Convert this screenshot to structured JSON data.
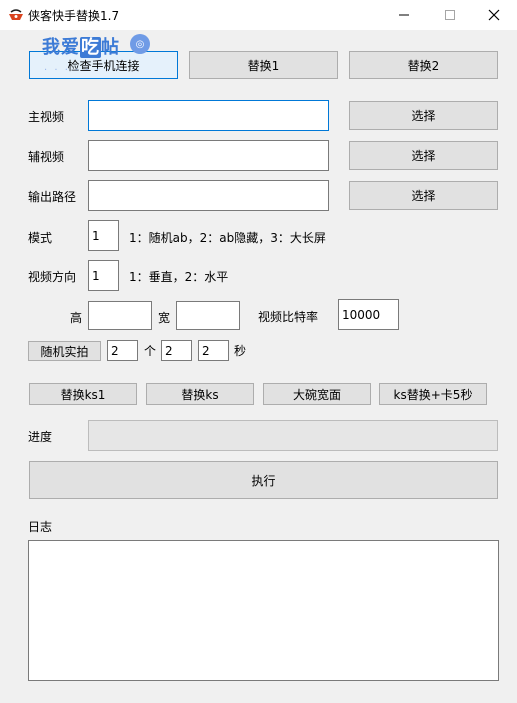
{
  "window": {
    "title": "侠客快手替换1.7",
    "minimize": "—",
    "maximize": "☐",
    "close": "✕"
  },
  "watermark": {
    "part1": "我爱",
    "part2": "吃",
    "part3": "帖",
    "badge": "◎"
  },
  "top_buttons": {
    "check_phone": "检查手机连接",
    "replace1": "替换1",
    "replace2": "替换2"
  },
  "fields": {
    "main_video": {
      "label": "主视频",
      "value": ""
    },
    "aux_video": {
      "label": "辅视频",
      "value": ""
    },
    "output_path": {
      "label": "输出路径",
      "value": ""
    },
    "choose_label": "选择"
  },
  "mode": {
    "label": "模式",
    "value": "1",
    "hint": "1：随机ab，2：ab隐藏，3：大长屏"
  },
  "orientation": {
    "label": "视频方向",
    "value": "1",
    "hint": "1：垂直，2：水平"
  },
  "dimensions": {
    "height_label": "高",
    "height_value": "",
    "width_label": "宽",
    "width_value": "",
    "bitrate_label": "视频比特率",
    "bitrate_value": "10000"
  },
  "random_shoot": {
    "button": "随机实拍",
    "count_value": "2",
    "count_unit": "个",
    "sec_from": "2",
    "sec_to": "2",
    "sec_unit": "秒"
  },
  "action_buttons": {
    "replace_ks1": "替换ks1",
    "replace_ks": "替换ks",
    "big_bowl": "大碗宽面",
    "ks_replace_card": "ks替换+卡5秒"
  },
  "progress": {
    "label": "进度",
    "value": 0
  },
  "execute_label": "执行",
  "log": {
    "label": "日志",
    "content": ""
  },
  "colors": {
    "accent": "#0078d7",
    "button_bg": "#e1e1e1",
    "window_bg": "#f0f0f0",
    "progress_fill": "#06b025"
  }
}
